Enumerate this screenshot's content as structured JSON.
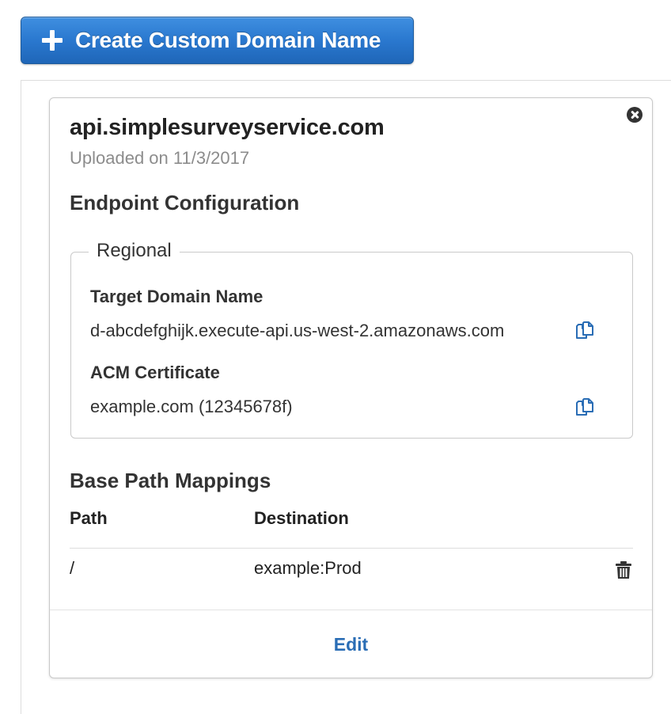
{
  "toolbar": {
    "create_button_label": "Create Custom Domain Name"
  },
  "domain_card": {
    "title": "api.simplesurveyservice.com",
    "uploaded": "Uploaded on 11/3/2017",
    "endpoint_configuration": {
      "heading": "Endpoint Configuration",
      "type_legend": "Regional",
      "target_domain_label": "Target Domain Name",
      "target_domain_value": "d-abcdefghijk.execute-api.us-west-2.amazonaws.com",
      "acm_certificate_label": "ACM Certificate",
      "acm_certificate_value": "example.com (12345678f)"
    },
    "base_path_mappings": {
      "heading": "Base Path Mappings",
      "columns": [
        "Path",
        "Destination"
      ],
      "rows": [
        {
          "path": "/",
          "destination": "example:Prod"
        }
      ]
    },
    "edit_label": "Edit"
  },
  "colors": {
    "primary_button": "#2a78cf",
    "link": "#2a6db5",
    "copy_icon": "#2a6db5",
    "text": "#333333",
    "muted_text": "#8c8c8c",
    "border": "#c9c9c9"
  },
  "icons": {
    "create": "plus-icon",
    "close": "close-icon",
    "copy": "copy-icon",
    "delete": "trash-icon"
  }
}
